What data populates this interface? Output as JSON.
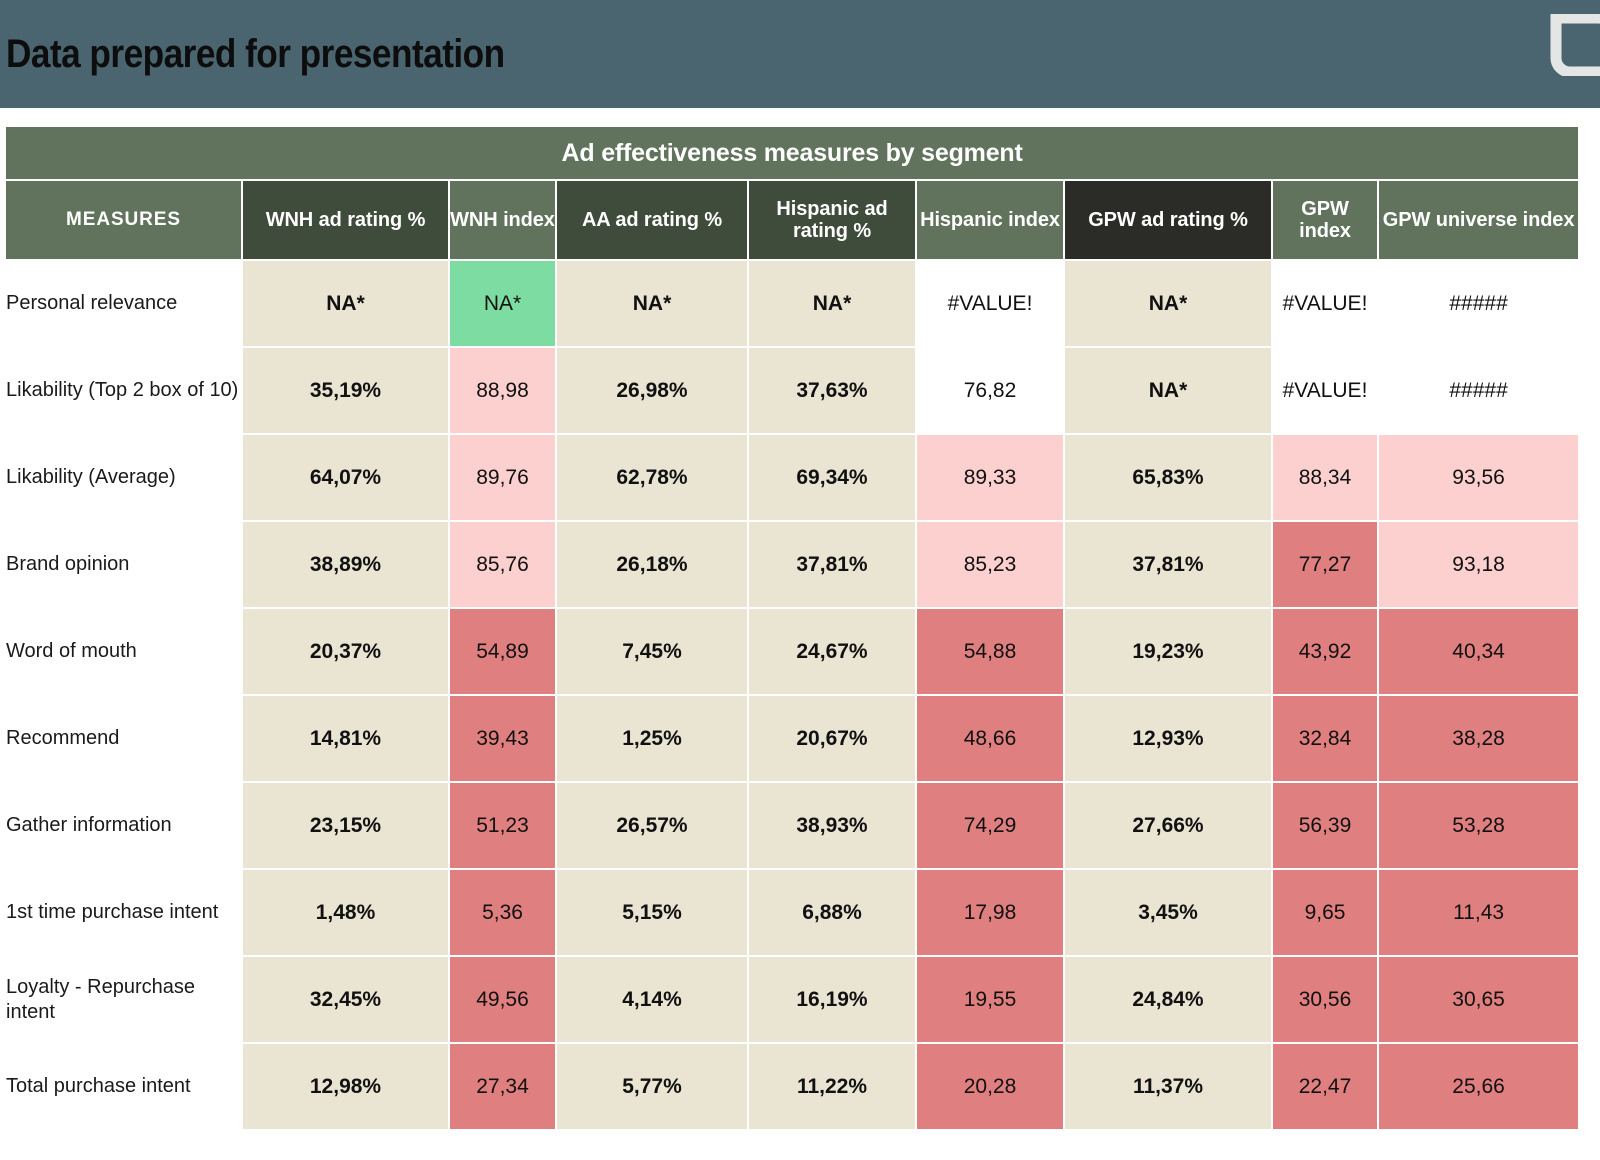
{
  "header": {
    "title": "Data prepared for presentation",
    "banner_color": "#4a6570",
    "logo_icon": "leaf-logo-icon"
  },
  "table": {
    "caption": "Ad effectiveness measures by segment",
    "measures_header": "MEASURES",
    "columns": [
      {
        "label": "WNH ad rating %",
        "style": "dark"
      },
      {
        "label": "WNH index",
        "style": "light"
      },
      {
        "label": "AA ad rating %",
        "style": "dark"
      },
      {
        "label": "Hispanic ad rating %",
        "style": "dark"
      },
      {
        "label": "Hispanic index",
        "style": "light"
      },
      {
        "label": "GPW ad rating %",
        "style": "black"
      },
      {
        "label": "GPW index",
        "style": "light"
      },
      {
        "label": "GPW universe index",
        "style": "light"
      }
    ],
    "rows": [
      {
        "label": "Personal relevance",
        "cells": [
          {
            "v": "NA*",
            "fill": "beige",
            "bold": true
          },
          {
            "v": "NA*",
            "fill": "green",
            "bold": false
          },
          {
            "v": "NA*",
            "fill": "beige",
            "bold": true
          },
          {
            "v": "NA*",
            "fill": "beige",
            "bold": true
          },
          {
            "v": "#VALUE!",
            "fill": "white",
            "bold": false
          },
          {
            "v": "NA*",
            "fill": "beige",
            "bold": true
          },
          {
            "v": "#VALUE!",
            "fill": "white",
            "bold": false
          },
          {
            "v": "#####",
            "fill": "white",
            "bold": false
          }
        ]
      },
      {
        "label": "Likability (Top 2 box of 10)",
        "cells": [
          {
            "v": "35,19%",
            "fill": "beige",
            "bold": true
          },
          {
            "v": "88,98",
            "fill": "pink",
            "bold": false
          },
          {
            "v": "26,98%",
            "fill": "beige",
            "bold": true
          },
          {
            "v": "37,63%",
            "fill": "beige",
            "bold": true
          },
          {
            "v": "76,82",
            "fill": "white",
            "bold": false
          },
          {
            "v": "NA*",
            "fill": "beige",
            "bold": true
          },
          {
            "v": "#VALUE!",
            "fill": "white",
            "bold": false
          },
          {
            "v": "#####",
            "fill": "white",
            "bold": false
          }
        ]
      },
      {
        "label": "Likability (Average)",
        "cells": [
          {
            "v": "64,07%",
            "fill": "beige",
            "bold": true
          },
          {
            "v": "89,76",
            "fill": "pink",
            "bold": false
          },
          {
            "v": "62,78%",
            "fill": "beige",
            "bold": true
          },
          {
            "v": "69,34%",
            "fill": "beige",
            "bold": true
          },
          {
            "v": "89,33",
            "fill": "pink",
            "bold": false
          },
          {
            "v": "65,83%",
            "fill": "beige",
            "bold": true
          },
          {
            "v": "88,34",
            "fill": "pink",
            "bold": false
          },
          {
            "v": "93,56",
            "fill": "pink",
            "bold": false
          }
        ]
      },
      {
        "label": "Brand opinion",
        "cells": [
          {
            "v": "38,89%",
            "fill": "beige",
            "bold": true
          },
          {
            "v": "85,76",
            "fill": "pink",
            "bold": false
          },
          {
            "v": "26,18%",
            "fill": "beige",
            "bold": true
          },
          {
            "v": "37,81%",
            "fill": "beige",
            "bold": true
          },
          {
            "v": "85,23",
            "fill": "pink",
            "bold": false
          },
          {
            "v": "37,81%",
            "fill": "beige",
            "bold": true
          },
          {
            "v": "77,27",
            "fill": "red",
            "bold": false
          },
          {
            "v": "93,18",
            "fill": "pink",
            "bold": false
          }
        ]
      },
      {
        "label": "Word of mouth",
        "cells": [
          {
            "v": "20,37%",
            "fill": "beige",
            "bold": true
          },
          {
            "v": "54,89",
            "fill": "red",
            "bold": false
          },
          {
            "v": "7,45%",
            "fill": "beige",
            "bold": true
          },
          {
            "v": "24,67%",
            "fill": "beige",
            "bold": true
          },
          {
            "v": "54,88",
            "fill": "red",
            "bold": false
          },
          {
            "v": "19,23%",
            "fill": "beige",
            "bold": true
          },
          {
            "v": "43,92",
            "fill": "red",
            "bold": false
          },
          {
            "v": "40,34",
            "fill": "red",
            "bold": false
          }
        ]
      },
      {
        "label": "Recommend",
        "cells": [
          {
            "v": "14,81%",
            "fill": "beige",
            "bold": true
          },
          {
            "v": "39,43",
            "fill": "red",
            "bold": false
          },
          {
            "v": "1,25%",
            "fill": "beige",
            "bold": true
          },
          {
            "v": "20,67%",
            "fill": "beige",
            "bold": true
          },
          {
            "v": "48,66",
            "fill": "red",
            "bold": false
          },
          {
            "v": "12,93%",
            "fill": "beige",
            "bold": true
          },
          {
            "v": "32,84",
            "fill": "red",
            "bold": false
          },
          {
            "v": "38,28",
            "fill": "red",
            "bold": false
          }
        ]
      },
      {
        "label": "Gather information",
        "cells": [
          {
            "v": "23,15%",
            "fill": "beige",
            "bold": true
          },
          {
            "v": "51,23",
            "fill": "red",
            "bold": false
          },
          {
            "v": "26,57%",
            "fill": "beige",
            "bold": true
          },
          {
            "v": "38,93%",
            "fill": "beige",
            "bold": true
          },
          {
            "v": "74,29",
            "fill": "red",
            "bold": false
          },
          {
            "v": "27,66%",
            "fill": "beige",
            "bold": true
          },
          {
            "v": "56,39",
            "fill": "red",
            "bold": false
          },
          {
            "v": "53,28",
            "fill": "red",
            "bold": false
          }
        ]
      },
      {
        "label": "1st time purchase intent",
        "cells": [
          {
            "v": "1,48%",
            "fill": "beige",
            "bold": true
          },
          {
            "v": "5,36",
            "fill": "red",
            "bold": false
          },
          {
            "v": "5,15%",
            "fill": "beige",
            "bold": true
          },
          {
            "v": "6,88%",
            "fill": "beige",
            "bold": true
          },
          {
            "v": "17,98",
            "fill": "red",
            "bold": false
          },
          {
            "v": "3,45%",
            "fill": "beige",
            "bold": true
          },
          {
            "v": "9,65",
            "fill": "red",
            "bold": false
          },
          {
            "v": "11,43",
            "fill": "red",
            "bold": false
          }
        ]
      },
      {
        "label": "Loyalty - Repurchase intent",
        "cells": [
          {
            "v": "32,45%",
            "fill": "beige",
            "bold": true
          },
          {
            "v": "49,56",
            "fill": "red",
            "bold": false
          },
          {
            "v": "4,14%",
            "fill": "beige",
            "bold": true,
            "text_color": "red"
          },
          {
            "v": "16,19%",
            "fill": "beige",
            "bold": true
          },
          {
            "v": "19,55",
            "fill": "red",
            "bold": false
          },
          {
            "v": "24,84%",
            "fill": "beige",
            "bold": true
          },
          {
            "v": "30,56",
            "fill": "red",
            "bold": false
          },
          {
            "v": "30,65",
            "fill": "red",
            "bold": false
          }
        ]
      },
      {
        "label": "Total purchase intent",
        "cells": [
          {
            "v": "12,98%",
            "fill": "beige",
            "bold": true
          },
          {
            "v": "27,34",
            "fill": "red",
            "bold": false
          },
          {
            "v": "5,77%",
            "fill": "beige",
            "bold": true
          },
          {
            "v": "11,22%",
            "fill": "beige",
            "bold": true
          },
          {
            "v": "20,28",
            "fill": "red",
            "bold": false
          },
          {
            "v": "11,37%",
            "fill": "beige",
            "bold": true
          },
          {
            "v": "22,47",
            "fill": "red",
            "bold": false
          },
          {
            "v": "25,66",
            "fill": "red",
            "bold": false
          }
        ]
      }
    ]
  },
  "colors": {
    "banner": "#4a6570",
    "header_light_green": "#61735c",
    "header_dark_green": "#3f4b3b",
    "header_black": "#2b2b28",
    "fill_beige": "#eae4d3",
    "fill_green": "#7cdca1",
    "fill_pink": "#fbd0ce",
    "fill_red": "#df7f7f",
    "text_red": "#c0504d"
  }
}
